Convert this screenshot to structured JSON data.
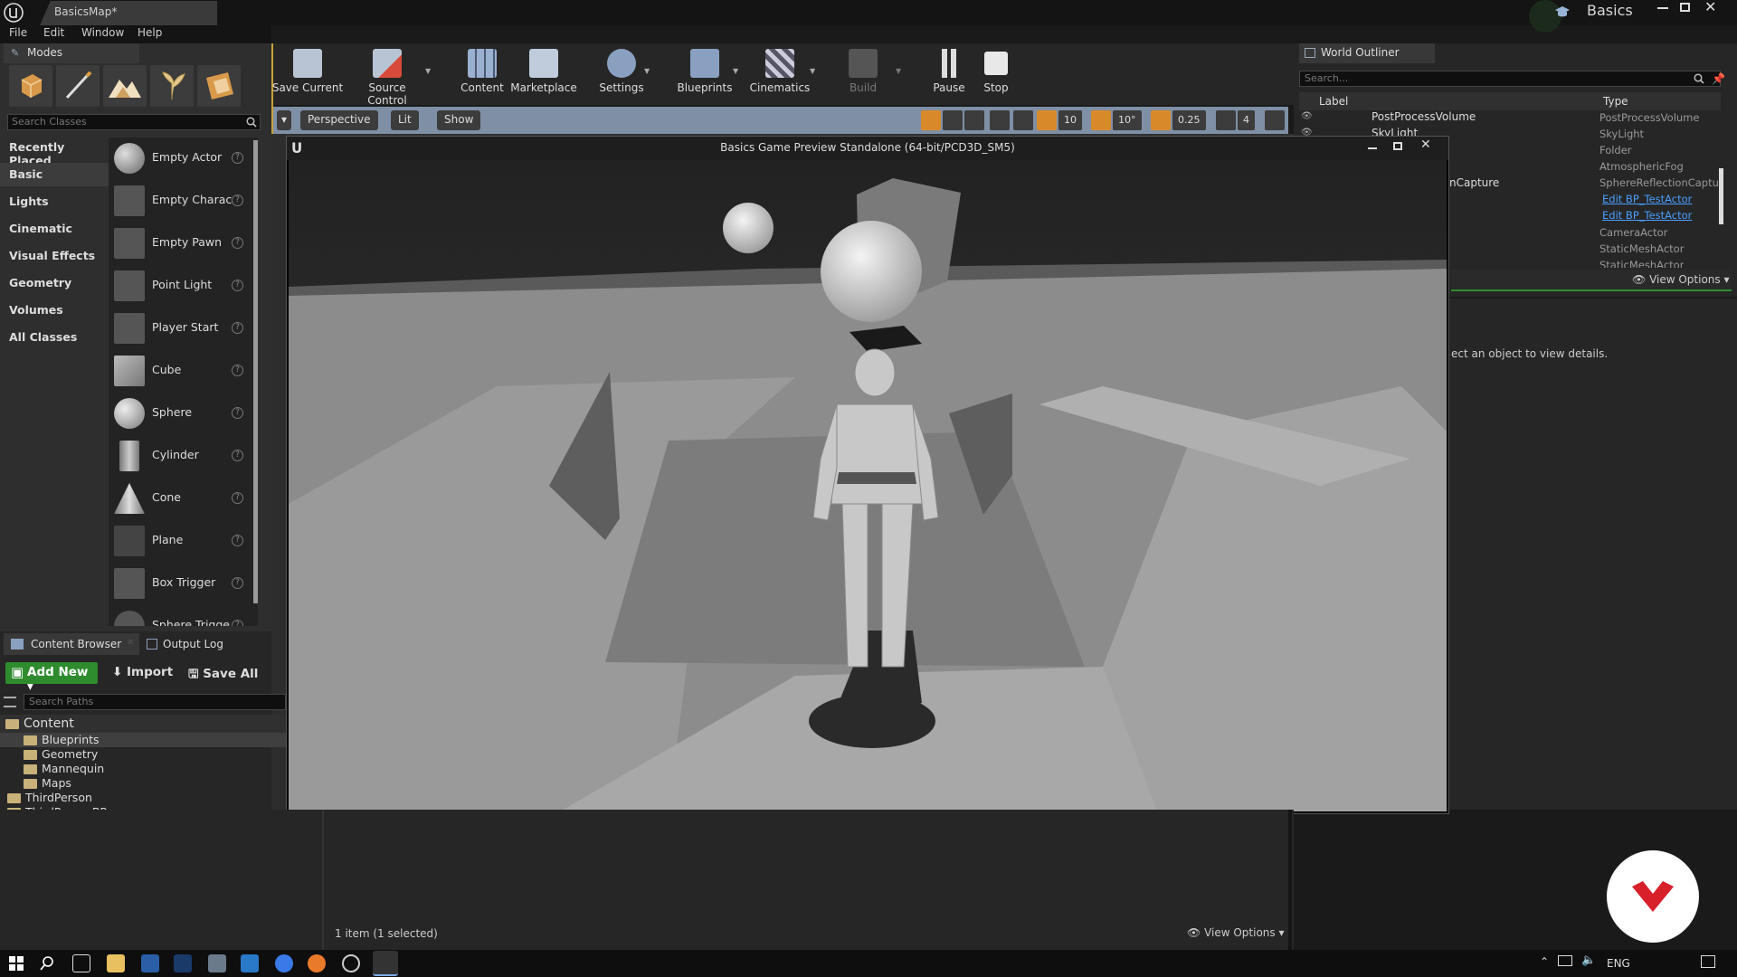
{
  "window": {
    "doc_tab": "BasicsMap*",
    "project_name": "Basics",
    "menu": [
      "File",
      "Edit",
      "Window",
      "Help"
    ]
  },
  "modes": {
    "tab": "Modes",
    "search_placeholder": "Search Classes",
    "categories": [
      "Recently Placed",
      "Basic",
      "Lights",
      "Cinematic",
      "Visual Effects",
      "Geometry",
      "Volumes",
      "All Classes"
    ],
    "active_category": "Basic",
    "classes": [
      "Empty Actor",
      "Empty Charac",
      "Empty Pawn",
      "Point Light",
      "Player Start",
      "Cube",
      "Sphere",
      "Cylinder",
      "Cone",
      "Plane",
      "Box Trigger",
      "Sphere Trigge"
    ]
  },
  "toolbar": {
    "save_current": "Save Current",
    "source_control": "Source Control",
    "content": "Content",
    "marketplace": "Marketplace",
    "settings": "Settings",
    "blueprints": "Blueprints",
    "cinematics": "Cinematics",
    "build": "Build",
    "pause": "Pause",
    "stop": "Stop"
  },
  "viewport": {
    "perspective": "Perspective",
    "lit": "Lit",
    "show": "Show",
    "grid_snap": "10",
    "rot_snap": "10°",
    "scale_snap": "0.25",
    "camera_speed": "4"
  },
  "pie": {
    "title": "Basics Game Preview Standalone (64-bit/PCD3D_SM5)"
  },
  "outliner": {
    "tab": "World Outliner",
    "search_placeholder": "Search...",
    "col_label": "Label",
    "col_type": "Type",
    "rows": [
      {
        "label": "PostProcessVolume",
        "type": "PostProcessVolume",
        "link": false
      },
      {
        "label": "SkyLight",
        "type": "SkyLight",
        "link": false
      },
      {
        "label": "",
        "type": "Folder",
        "link": false
      },
      {
        "label": "",
        "type": "AtmosphericFog",
        "link": false
      },
      {
        "label": "nCapture",
        "type": "SphereReflectionCaptur",
        "link": false
      },
      {
        "label": "",
        "type": "Edit BP_TestActor",
        "link": true
      },
      {
        "label": "",
        "type": "Edit BP_TestActor",
        "link": true
      },
      {
        "label": "",
        "type": "CameraActor",
        "link": false
      },
      {
        "label": "",
        "type": "StaticMeshActor",
        "link": false
      },
      {
        "label": "",
        "type": "StaticMeshActor",
        "link": false
      }
    ],
    "view_options": "View Options"
  },
  "details": {
    "hint": "ect an object to view details."
  },
  "content_browser": {
    "tab": "Content Browser",
    "output_tab": "Output Log",
    "add_new": "Add New",
    "import": "Import",
    "save_all": "Save All",
    "search_placeholder": "Search Paths",
    "root": "Content",
    "folders": [
      "Blueprints",
      "Geometry",
      "Mannequin",
      "Maps",
      "ThirdPerson",
      "ThirdPersonBP"
    ],
    "selected_folder": "Blueprints",
    "status": "1 item (1 selected)",
    "view_options": "View Options"
  },
  "taskbar": {
    "lang": "ENG"
  },
  "colors": {
    "accent_green": "#2e8b2e",
    "viewport_bar": "#7f8fa5",
    "link_blue": "#4a9fff",
    "viewport_active_border": "#c9a03a"
  }
}
